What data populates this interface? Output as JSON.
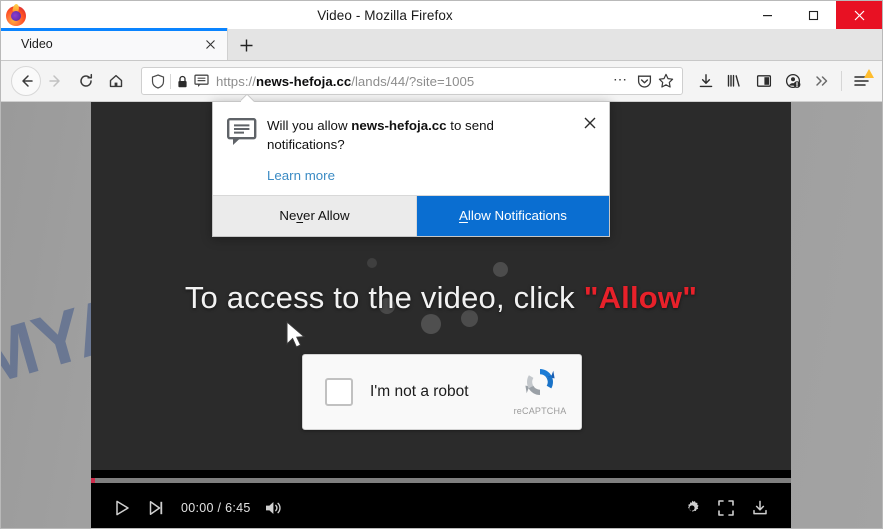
{
  "window": {
    "title": "Video - Mozilla Firefox",
    "logo_icon": "firefox-logo",
    "minimize_label": "Minimize",
    "maximize_label": "Maximize",
    "close_label": "Close"
  },
  "tabs": {
    "active": {
      "label": "Video",
      "close_icon": "close-icon"
    },
    "new_tab_label": "+"
  },
  "toolbar": {
    "back_icon": "back-arrow-icon",
    "forward_icon": "forward-arrow-icon",
    "reload_icon": "reload-icon",
    "home_icon": "home-icon",
    "url": {
      "scheme": "https://",
      "domain": "news-hefoja.cc",
      "path": "/lands/44/?site=1005",
      "shield_icon": "tracking-protection-shield-icon",
      "lock_icon": "padlock-icon",
      "notification_icon": "notification-permission-icon",
      "page_actions_icon": "ellipsis-icon",
      "pocket_icon": "pocket-icon",
      "bookmark_icon": "star-icon"
    },
    "icons": [
      {
        "name": "downloads-icon"
      },
      {
        "name": "library-icon"
      },
      {
        "name": "sidebar-icon"
      },
      {
        "name": "account-icon"
      },
      {
        "name": "overflow-chevrons-icon"
      },
      {
        "name": "hamburger-menu-icon"
      }
    ]
  },
  "popup": {
    "icon": "speech-bubble-icon",
    "question_prefix": "Will you allow ",
    "question_domain": "news-hefoja.cc",
    "question_suffix": " to send notifications?",
    "learn_more": "Learn more",
    "close_icon": "close-icon",
    "never_allow": "Never Allow",
    "never_allow_pre": "Ne",
    "never_allow_key": "v",
    "never_allow_post": "er Allow",
    "allow": "Allow Notifications",
    "allow_key": "A",
    "allow_post": "llow Notifications",
    "accent_color": "#0a6ed1"
  },
  "page": {
    "watermark": "MYANTISPYWARE.COM",
    "watermark_color": "#1f3f82",
    "background_color": "#9e9e9e",
    "video_background": "#2b2b2b",
    "headline_prefix": "To access to the video, click ",
    "headline_allow": "\"Allow\"",
    "headline_allow_color": "#e8212a",
    "cursor_icon": "mouse-pointer-icon",
    "spinner_icon": "loading-spinner-icon"
  },
  "captcha": {
    "checkbox_label": "I'm not a robot",
    "brand": "reCAPTCHA",
    "logo_icon": "recaptcha-logo-icon",
    "checkbox_icon": "checkbox-unchecked-icon"
  },
  "player": {
    "play_icon": "play-icon",
    "next_icon": "next-track-icon",
    "time": "00:00 / 6:45",
    "current_time": "00:00",
    "duration": "6:45",
    "volume_icon": "volume-on-icon",
    "settings_icon": "gear-icon",
    "fullscreen_icon": "fullscreen-icon",
    "download_icon": "download-icon",
    "progress_percent": 0,
    "progress_color": "#cf2b4b",
    "track_color": "#7f7f7f"
  }
}
